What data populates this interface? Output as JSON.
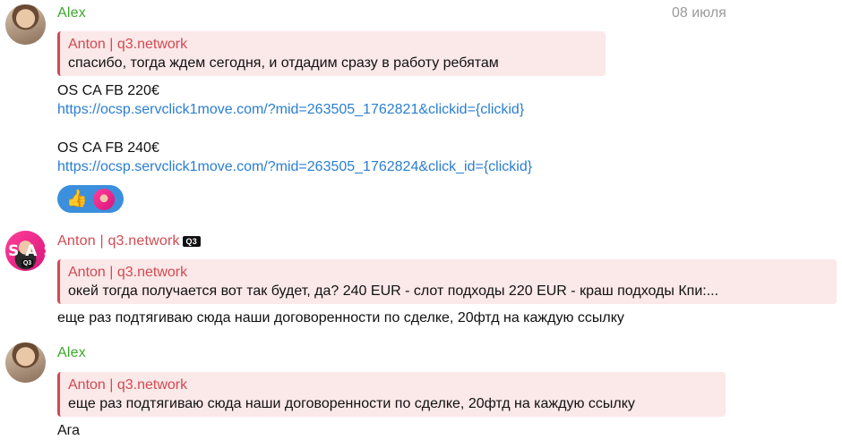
{
  "messages": [
    {
      "sender": "Alex",
      "date": "08 июля",
      "reply": {
        "name": "Anton | q3.network",
        "text": "спасибо, тогда ждем сегодня, и отдадим сразу в работу ребятам"
      },
      "lines": [
        "OS CA FB 220€",
        "https://ocsp.servclick1move.com/?mid=263505_1762821&clickid={clickid}",
        "OS CA FB 240€",
        "https://ocsp.servclick1move.com/?mid=263505_1762824&click_id={clickid}"
      ],
      "reactions": [
        "thumbs-up-icon",
        "avatar-anton"
      ]
    },
    {
      "sender": "Anton | q3.network",
      "badge": "Q3",
      "reply": {
        "name": "Anton | q3.network",
        "text": "окей тогда получается вот так будет, да?   240 EUR - слот подходы  220 EUR - краш подходы   Кпи:..."
      },
      "text": "еще раз подтягиваю сюда наши договоренности по сделке, 20фтд на каждую ссылку"
    },
    {
      "sender": "Alex",
      "reply": {
        "name": "Anton | q3.network",
        "text": "еще раз подтягиваю сюда наши договоренности по сделке, 20фтд на каждую ссылку"
      },
      "text": "Ага"
    }
  ],
  "colors": {
    "alex_name": "#3ca62c",
    "anton_name": "#d14a52",
    "link": "#2a7ed1",
    "reply_bg": "#fbe8e8",
    "reaction_bg": "#3b8fdc"
  }
}
